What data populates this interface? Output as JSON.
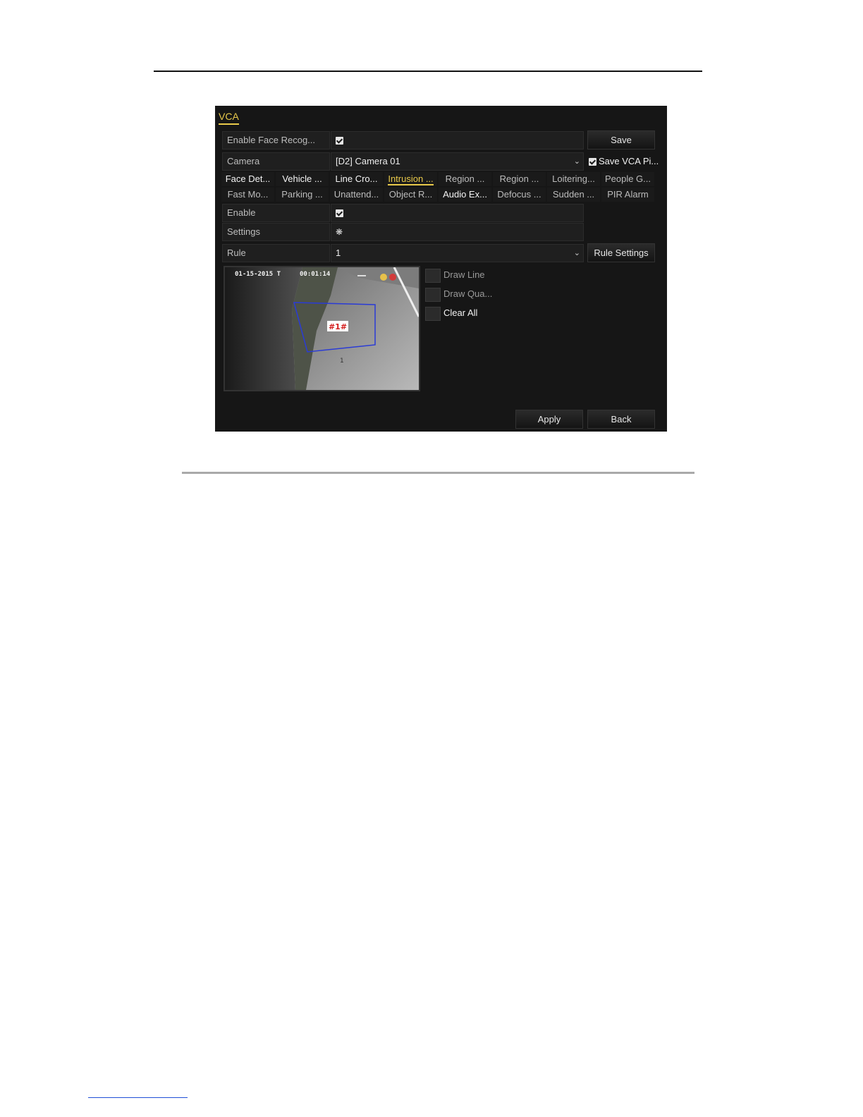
{
  "window": {
    "tab": "VCA"
  },
  "form": {
    "enable_face_label": "Enable Face Recog...",
    "camera_label": "Camera",
    "camera_value": "[D2] Camera 01",
    "save_vca_pic_label": "Save VCA Pi...",
    "enable_label": "Enable",
    "settings_label": "Settings",
    "settings_icon": "gear-icon",
    "rule_label": "Rule",
    "rule_value": "1"
  },
  "buttons": {
    "save": "Save",
    "rule_settings": "Rule Settings",
    "apply": "Apply",
    "back": "Back"
  },
  "event_tabs_row1": [
    "Face Det...",
    "Vehicle ...",
    "Line Cro...",
    "Intrusion ...",
    "Region ...",
    "Region ...",
    "Loitering...",
    "People G..."
  ],
  "event_tabs_row2": [
    "Fast Mo...",
    "Parking ...",
    "Unattend...",
    "Object R...",
    "Audio Ex...",
    "Defocus ...",
    "Sudden ...",
    "PIR Alarm"
  ],
  "active_tab": "Intrusion ...",
  "preview": {
    "timestamp": "01-15-2015 T",
    "time": "00:01:14",
    "region_label": "#1#",
    "channel": "1"
  },
  "draw_tools": {
    "draw_line": "Draw Line",
    "draw_quad": "Draw Qua...",
    "clear_all": "Clear All"
  },
  "colors": {
    "accent": "#e8c94a",
    "background": "#161616",
    "region": "#2a3bd6"
  }
}
